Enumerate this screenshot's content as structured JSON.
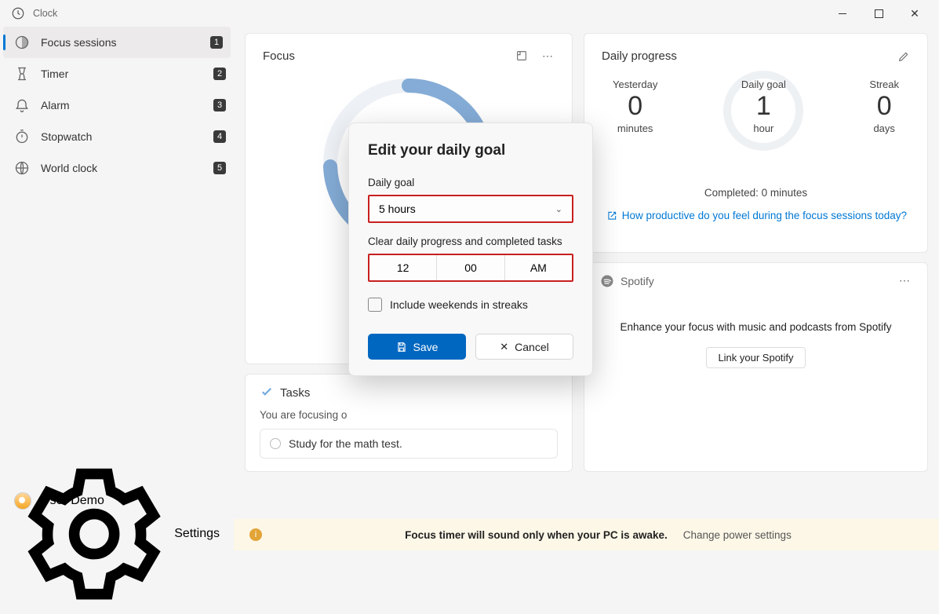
{
  "app": {
    "title": "Clock"
  },
  "sidebar": {
    "items": [
      {
        "label": "Focus sessions",
        "badge": "1"
      },
      {
        "label": "Timer",
        "badge": "2"
      },
      {
        "label": "Alarm",
        "badge": "3"
      },
      {
        "label": "Stopwatch",
        "badge": "4"
      },
      {
        "label": "World clock",
        "badge": "5"
      }
    ],
    "user": "User Demo",
    "settings": "Settings"
  },
  "focus": {
    "title": "Focus"
  },
  "tasks": {
    "title": "Tasks",
    "subtitle": "You are focusing o",
    "item": "Study for the math test."
  },
  "progress": {
    "title": "Daily progress",
    "yesterday_label": "Yesterday",
    "yesterday_value": "0",
    "yesterday_unit": "minutes",
    "goal_label": "Daily goal",
    "goal_value": "1",
    "goal_unit": "hour",
    "streak_label": "Streak",
    "streak_value": "0",
    "streak_unit": "days",
    "completed": "Completed: 0 minutes",
    "feedback": "How productive do you feel during the focus sessions today?"
  },
  "spotify": {
    "title": "Spotify",
    "desc": "Enhance your focus with music and podcasts from Spotify",
    "link_label": "Link your Spotify"
  },
  "modal": {
    "title": "Edit your daily goal",
    "goal_label": "Daily goal",
    "goal_value": "5 hours",
    "clear_label": "Clear daily progress and completed tasks",
    "time_h": "12",
    "time_m": "00",
    "time_ap": "AM",
    "weekends": "Include weekends in streaks",
    "save": "Save",
    "cancel": "Cancel"
  },
  "notebar": {
    "msg": "Focus timer will sound only when your PC is awake.",
    "link": "Change power settings"
  }
}
